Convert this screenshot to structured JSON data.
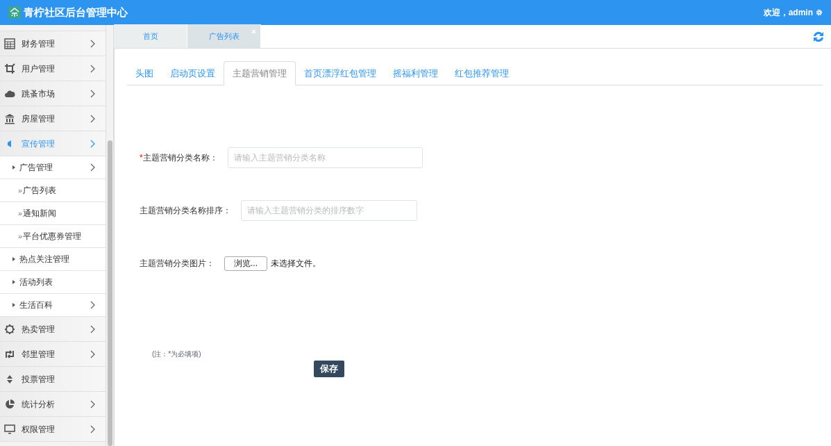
{
  "header": {
    "title": "青柠社区后台管理中心",
    "welcome": "欢迎，admin"
  },
  "sidebar": {
    "items": [
      {
        "label": "财务管理",
        "selected": false,
        "expandable": true
      },
      {
        "label": "用户管理",
        "selected": false,
        "expandable": true
      },
      {
        "label": "跳蚤市场",
        "selected": false,
        "expandable": true
      },
      {
        "label": "房屋管理",
        "selected": false,
        "expandable": true
      },
      {
        "label": "宣传管理",
        "selected": true,
        "expandable": true,
        "children": [
          {
            "label": "广告管理",
            "expandable": true,
            "children": [
              {
                "marker": "»",
                "label": "广告列表"
              },
              {
                "marker": "»",
                "label": "通知新闻"
              },
              {
                "marker": "»",
                "label": "平台优惠券管理"
              }
            ]
          },
          {
            "label": "热点关注管理",
            "expandable": false
          },
          {
            "label": "活动列表",
            "expandable": false
          },
          {
            "label": "生活百科",
            "expandable": true
          }
        ]
      },
      {
        "label": "热卖管理",
        "selected": false,
        "expandable": true
      },
      {
        "label": "邻里管理",
        "selected": false,
        "expandable": true
      },
      {
        "label": "投票管理",
        "selected": false,
        "expandable": false
      },
      {
        "label": "统计分析",
        "selected": false,
        "expandable": true
      },
      {
        "label": "权限管理",
        "selected": false,
        "expandable": true
      }
    ]
  },
  "page_tabs": [
    {
      "label": "首页",
      "selected": false,
      "closable": false
    },
    {
      "label": "广告列表",
      "selected": true,
      "closable": true
    }
  ],
  "tabs": [
    {
      "label": "头图",
      "selected": false
    },
    {
      "label": "启动页设置",
      "selected": false
    },
    {
      "label": "主题营销管理",
      "selected": true
    },
    {
      "label": "首页漂浮红包管理",
      "selected": false
    },
    {
      "label": "摇福利管理",
      "selected": false
    },
    {
      "label": "红包推荐管理",
      "selected": false
    }
  ],
  "form": {
    "fields": [
      {
        "kind": "text",
        "required_mark": "*",
        "label": "主题营销分类名称：",
        "placeholder": "请输入主题营销分类名称"
      },
      {
        "kind": "text",
        "label": "主题营销分类名称排序：",
        "placeholder": "请输入主题营销分类的排序数字"
      },
      {
        "kind": "file",
        "label": "主题营销分类图片：",
        "button": "浏览...",
        "status": "未选择文件。"
      }
    ],
    "note": "(注：*为必填项)",
    "save": "保存"
  }
}
